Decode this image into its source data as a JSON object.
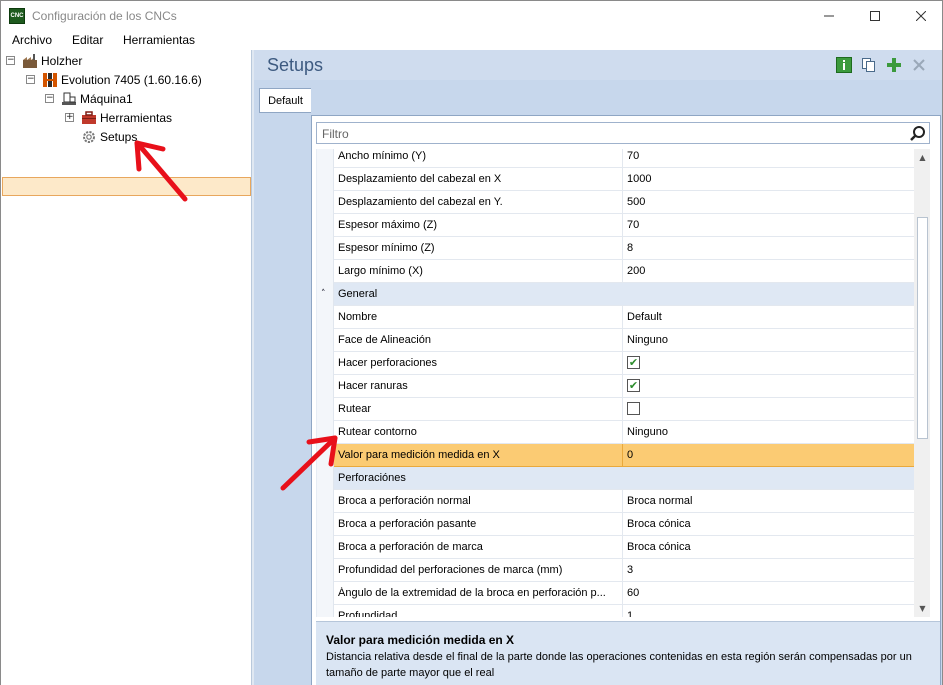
{
  "window": {
    "title": "Configuración de los CNCs",
    "app_icon_text": "CNC",
    "controls": [
      "minimize",
      "maximize",
      "close"
    ]
  },
  "menu": [
    "Archivo",
    "Editar",
    "Herramientas"
  ],
  "tree": {
    "root": "Holzher",
    "machine_group": "Evolution 7405 (1.60.16.6)",
    "machine": "Máquina1",
    "tools": "Herramientas",
    "setups": "Setups"
  },
  "panel": {
    "title": "Setups",
    "tab": "Default",
    "filter_placeholder": "Filtro"
  },
  "properties": [
    {
      "name": "Ancho mínimo (Y)",
      "value": "70"
    },
    {
      "name": "Desplazamiento del cabezal en X",
      "value": "1000"
    },
    {
      "name": "Desplazamiento del cabezal en Y.",
      "value": "500"
    },
    {
      "name": "Espesor máximo (Z)",
      "value": "70"
    },
    {
      "name": "Espesor mínimo (Z)",
      "value": "8"
    },
    {
      "name": "Largo mínimo (X)",
      "value": "200"
    },
    {
      "category": "General"
    },
    {
      "name": "Nombre",
      "value": "Default"
    },
    {
      "name": "Face de Alineación",
      "value": "Ninguno"
    },
    {
      "name": "Hacer perforaciones",
      "checked": true
    },
    {
      "name": "Hacer ranuras",
      "checked": true
    },
    {
      "name": "Rutear",
      "checked": false
    },
    {
      "name": "Rutear contorno",
      "value": "Ninguno"
    },
    {
      "name": "Valor para medición medida en X",
      "value": "0",
      "selected": true
    },
    {
      "category": "Perforaciónes"
    },
    {
      "name": "Broca a perforación normal",
      "value": "Broca normal"
    },
    {
      "name": "Broca a perforación pasante",
      "value": "Broca cónica"
    },
    {
      "name": "Broca a perforación de marca",
      "value": "Broca cónica"
    },
    {
      "name": "Profundidad del perforaciones de marca (mm)",
      "value": "3"
    },
    {
      "name": "Ángulo de la extremidad de la broca en perforación p...",
      "value": "60"
    },
    {
      "name": "Profundidad ...",
      "value": "1"
    }
  ],
  "description": {
    "title": "Valor para medición medida en X",
    "text": "Distancia relativa desde el final de la parte donde las operaciones contenidas en esta región serán compensadas por un tamaño de parte mayor que el real"
  },
  "colors": {
    "selection": "#fbcb73",
    "panel_bg": "#c7d7ec",
    "annotation_arrow": "#e8101a"
  }
}
